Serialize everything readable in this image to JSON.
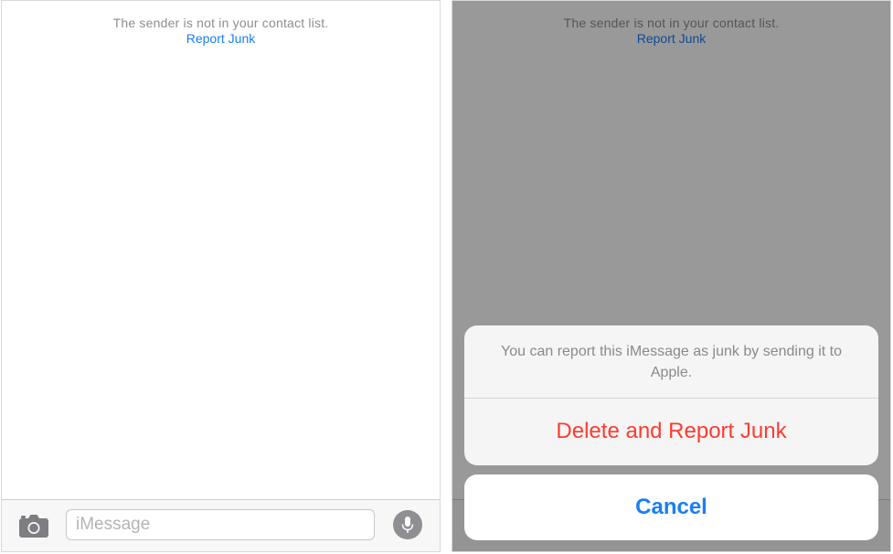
{
  "conversation": {
    "notice_text": "The sender is not in your contact list.",
    "report_link": "Report Junk"
  },
  "compose": {
    "placeholder": "iMessage",
    "camera_icon": "camera-icon",
    "mic_icon": "microphone-icon"
  },
  "action_sheet": {
    "message": "You can report this iMessage as junk by sending it to Apple.",
    "delete_report_label": "Delete and Report Junk",
    "cancel_label": "Cancel"
  },
  "colors": {
    "link_blue": "#1a7ef5",
    "destructive_red": "#ff3b30",
    "notice_gray": "#8e8e93"
  }
}
